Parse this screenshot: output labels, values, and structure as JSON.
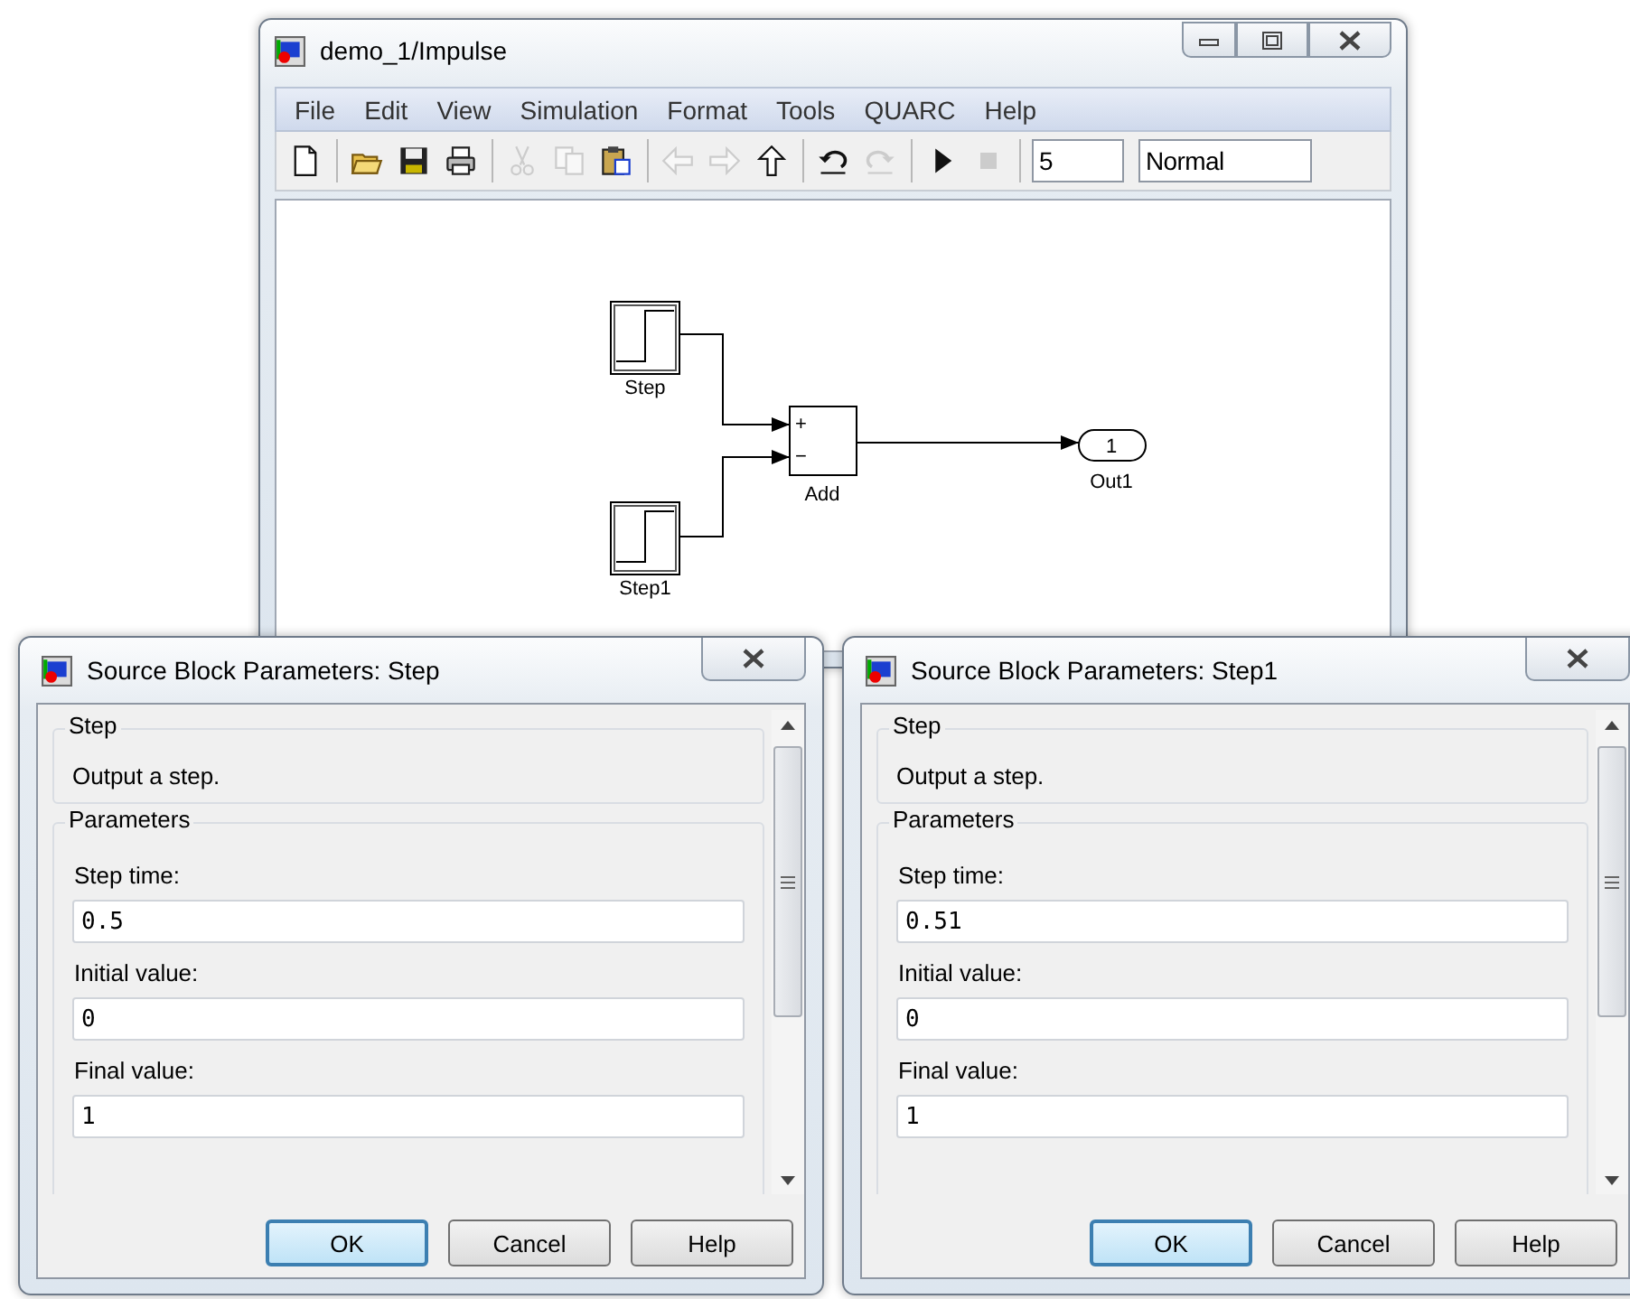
{
  "main_window": {
    "title": "demo_1/Impulse",
    "menu": [
      "File",
      "Edit",
      "View",
      "Simulation",
      "Format",
      "Tools",
      "QUARC",
      "Help"
    ],
    "toolbar_groups": [
      {
        "items": [
          {
            "kind": "new",
            "disabled": false
          }
        ]
      },
      {
        "items": [
          {
            "kind": "open",
            "disabled": false
          },
          {
            "kind": "save",
            "disabled": false
          },
          {
            "kind": "print",
            "disabled": false
          }
        ]
      },
      {
        "items": [
          {
            "kind": "cut",
            "disabled": true
          },
          {
            "kind": "copy",
            "disabled": true
          },
          {
            "kind": "paste",
            "disabled": false
          }
        ]
      },
      {
        "items": [
          {
            "kind": "back",
            "disabled": true
          },
          {
            "kind": "forward",
            "disabled": true
          },
          {
            "kind": "up",
            "disabled": false
          }
        ]
      },
      {
        "items": [
          {
            "kind": "undo",
            "disabled": false
          },
          {
            "kind": "redo",
            "disabled": true
          }
        ]
      },
      {
        "items": [
          {
            "kind": "play",
            "disabled": false
          },
          {
            "kind": "stop",
            "disabled": true
          }
        ]
      }
    ],
    "stop_time": "5",
    "sim_mode": "Normal",
    "diagram": {
      "blocks": [
        {
          "kind": "step",
          "label": "Step"
        },
        {
          "kind": "step",
          "label": "Step1"
        },
        {
          "kind": "sum",
          "label": "Add",
          "signs": [
            "+",
            "−"
          ]
        },
        {
          "kind": "outport",
          "label": "Out1",
          "number": "1"
        }
      ]
    }
  },
  "dialogs": [
    {
      "title": "Source Block Parameters: Step",
      "section": "Step",
      "description": "Output a step.",
      "group": "Parameters",
      "fields": [
        {
          "label": "Step time:",
          "value": "0.5"
        },
        {
          "label": "Initial value:",
          "value": "0"
        },
        {
          "label": "Final value:",
          "value": "1"
        }
      ],
      "buttons": [
        {
          "label": "OK",
          "default": true
        },
        {
          "label": "Cancel",
          "default": false
        },
        {
          "label": "Help",
          "default": false
        }
      ]
    },
    {
      "title": "Source Block Parameters: Step1",
      "section": "Step",
      "description": "Output a step.",
      "group": "Parameters",
      "fields": [
        {
          "label": "Step time:",
          "value": "0.51"
        },
        {
          "label": "Initial value:",
          "value": "0"
        },
        {
          "label": "Final value:",
          "value": "1"
        }
      ],
      "buttons": [
        {
          "label": "OK",
          "default": true
        },
        {
          "label": "Cancel",
          "default": false
        },
        {
          "label": "Help",
          "default": false
        }
      ]
    }
  ]
}
